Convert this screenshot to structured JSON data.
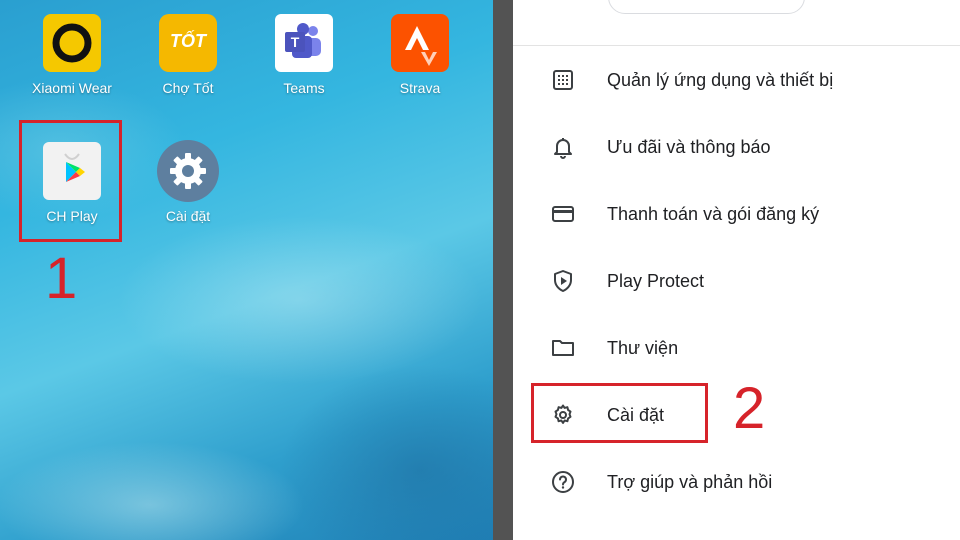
{
  "home": {
    "apps": [
      {
        "label": "Xiaomi Wear",
        "icon": "xiaomi-wear-icon"
      },
      {
        "label": "Chợ Tốt",
        "icon": "cho-tot-icon",
        "icon_text": "TỐT"
      },
      {
        "label": "Teams",
        "icon": "teams-icon"
      },
      {
        "label": "Strava",
        "icon": "strava-icon"
      },
      {
        "label": "CH Play",
        "icon": "google-play-icon"
      },
      {
        "label": "Cài đặt",
        "icon": "settings-gear-icon"
      }
    ],
    "step_label": "1"
  },
  "menu": {
    "items": [
      {
        "label": "Quản lý ứng dụng và thiết bị",
        "icon": "apps-grid-icon"
      },
      {
        "label": "Ưu đãi và thông báo",
        "icon": "bell-icon"
      },
      {
        "label": "Thanh toán và gói đăng ký",
        "icon": "credit-card-icon"
      },
      {
        "label": "Play Protect",
        "icon": "shield-play-icon"
      },
      {
        "label": "Thư viện",
        "icon": "folder-icon"
      },
      {
        "label": "Cài đặt",
        "icon": "gear-icon"
      },
      {
        "label": "Trợ giúp và phản hồi",
        "icon": "help-circle-icon"
      }
    ],
    "step_label": "2"
  },
  "colors": {
    "highlight": "#d6232a",
    "xiaomi_wear": "#f5c800",
    "cho_tot": "#f5b800",
    "strava": "#fc5200",
    "divider": "#535353"
  }
}
